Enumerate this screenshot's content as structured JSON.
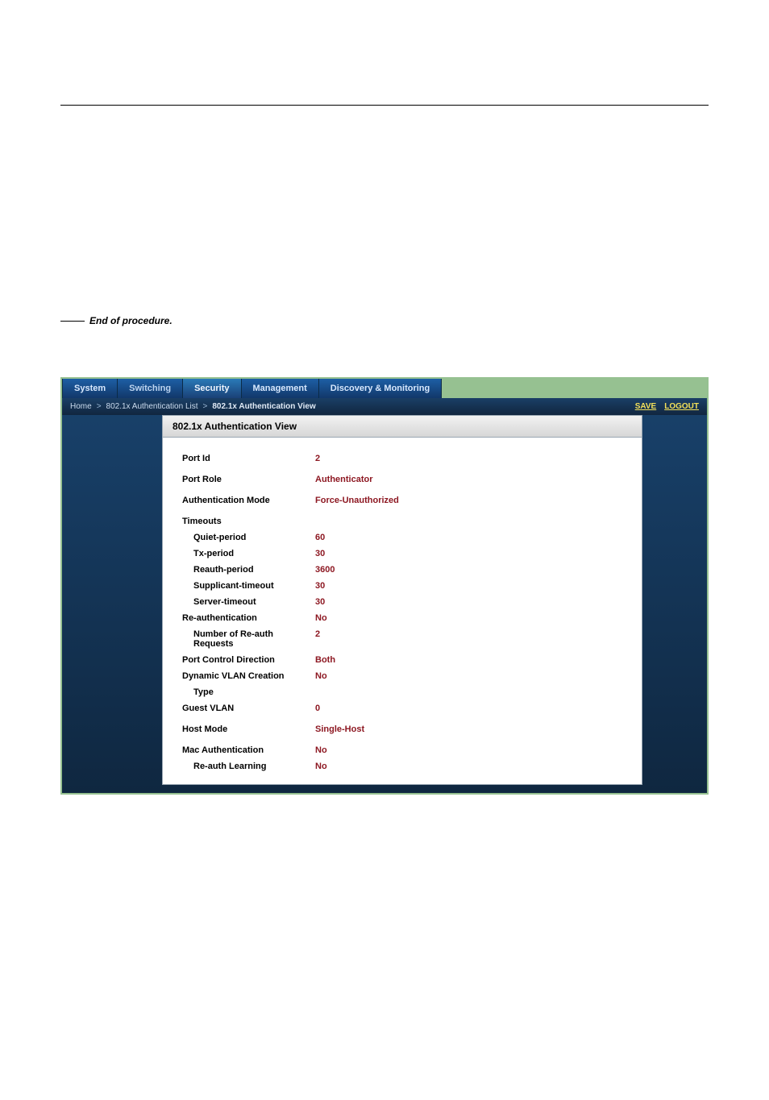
{
  "proc": {
    "end_marker": "End of procedure."
  },
  "menu": {
    "system": "System",
    "switching": "Switching",
    "security": "Security",
    "management": "Management",
    "discovery": "Discovery & Monitoring"
  },
  "breadbar": {
    "home": "Home",
    "sep": ">",
    "l1": "802.1x Authentication List",
    "l2": "802.1x Authentication View",
    "save": "SAVE",
    "logout": "LOGOUT"
  },
  "panel": {
    "title": "802.1x Authentication View"
  },
  "fields": {
    "portId": {
      "label": "Port Id",
      "value": "2"
    },
    "portRole": {
      "label": "Port Role",
      "value": "Authenticator"
    },
    "authMode": {
      "label": "Authentication Mode",
      "value": "Force-Unauthorized"
    },
    "timeouts": {
      "label": "Timeouts"
    },
    "quiet": {
      "label": "Quiet-period",
      "value": "60"
    },
    "tx": {
      "label": "Tx-period",
      "value": "30"
    },
    "reauthp": {
      "label": "Reauth-period",
      "value": "3600"
    },
    "supp": {
      "label": "Supplicant-timeout",
      "value": "30"
    },
    "server": {
      "label": "Server-timeout",
      "value": "30"
    },
    "reauth": {
      "label": "Re-authentication",
      "value": "No"
    },
    "nreauth": {
      "label": "Number of Re-auth Requests",
      "value": "2"
    },
    "pcdir": {
      "label": "Port Control Direction",
      "value": "Both"
    },
    "dvlan": {
      "label": "Dynamic VLAN Creation",
      "value": "No"
    },
    "type": {
      "label": "Type",
      "value": ""
    },
    "gvlan": {
      "label": "Guest VLAN",
      "value": "0"
    },
    "hostmode": {
      "label": "Host Mode",
      "value": "Single-Host"
    },
    "macauth": {
      "label": "Mac Authentication",
      "value": "No"
    },
    "relearn": {
      "label": "Re-auth Learning",
      "value": "No"
    }
  }
}
